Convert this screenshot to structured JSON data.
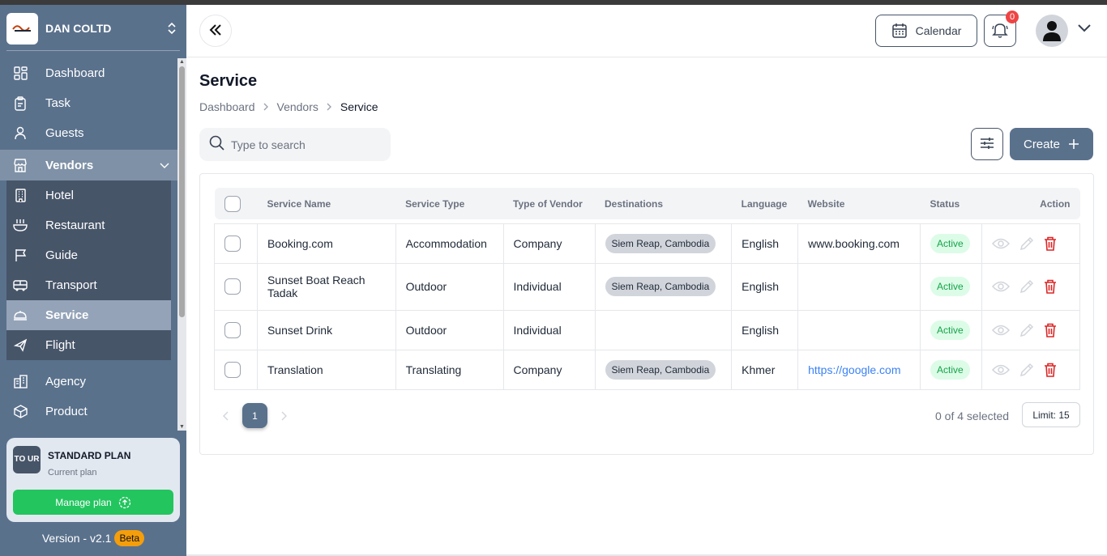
{
  "org": {
    "name": "DAN COLTD"
  },
  "nav": {
    "items": [
      {
        "label": "Dashboard",
        "icon": "dashboard-icon"
      },
      {
        "label": "Task",
        "icon": "clipboard-icon"
      },
      {
        "label": "Guests",
        "icon": "user-icon"
      }
    ],
    "vendors": {
      "label": "Vendors",
      "icon": "store-icon",
      "children": [
        {
          "label": "Hotel",
          "icon": "building-icon"
        },
        {
          "label": "Restaurant",
          "icon": "bowl-icon"
        },
        {
          "label": "Guide",
          "icon": "flag-icon"
        },
        {
          "label": "Transport",
          "icon": "bus-icon"
        },
        {
          "label": "Service",
          "icon": "service-icon",
          "active": true
        },
        {
          "label": "Flight",
          "icon": "plane-icon"
        }
      ]
    },
    "after": [
      {
        "label": "Agency",
        "icon": "agency-icon"
      },
      {
        "label": "Product",
        "icon": "box-icon"
      }
    ]
  },
  "plan": {
    "logo_text": "TO UR",
    "name": "STANDARD PLAN",
    "sub": "Current plan",
    "manage_label": "Manage plan"
  },
  "version": {
    "label": "Version - v2.1",
    "badge": "Beta"
  },
  "header": {
    "calendar_label": "Calendar",
    "notification_count": "0"
  },
  "page": {
    "title": "Service",
    "breadcrumb": [
      "Dashboard",
      "Vendors",
      "Service"
    ]
  },
  "search": {
    "placeholder": "Type to search"
  },
  "toolbar": {
    "create_label": "Create"
  },
  "table": {
    "columns": [
      "Service Name",
      "Service Type",
      "Type of Vendor",
      "Destinations",
      "Language",
      "Website",
      "Status",
      "Action"
    ],
    "rows": [
      {
        "name": "Booking.com",
        "type": "Accommodation",
        "vendor_type": "Company",
        "destination": "Siem Reap, Cambodia",
        "language": "English",
        "website": "www.booking.com",
        "status": "Active"
      },
      {
        "name": "Sunset Boat Reach Tadak",
        "type": "Outdoor",
        "vendor_type": "Individual",
        "destination": "Siem Reap, Cambodia",
        "language": "English",
        "website": "",
        "status": "Active"
      },
      {
        "name": "Sunset Drink",
        "type": "Outdoor",
        "vendor_type": "Individual",
        "destination": "",
        "language": "English",
        "website": "",
        "status": "Active"
      },
      {
        "name": "Translation",
        "type": "Translating",
        "vendor_type": "Company",
        "destination": "Siem Reap, Cambodia",
        "language": "Khmer",
        "website": "https://google.com",
        "status": "Active"
      }
    ]
  },
  "pagination": {
    "current_page": "1",
    "selected_info": "0 of 4 selected",
    "limit_label": "Limit: 15"
  },
  "colors": {
    "sidebar": "#5a718c",
    "accent": "#5a718c",
    "success": "#22c55e",
    "danger": "#dc2626",
    "link": "#3b82f6"
  }
}
